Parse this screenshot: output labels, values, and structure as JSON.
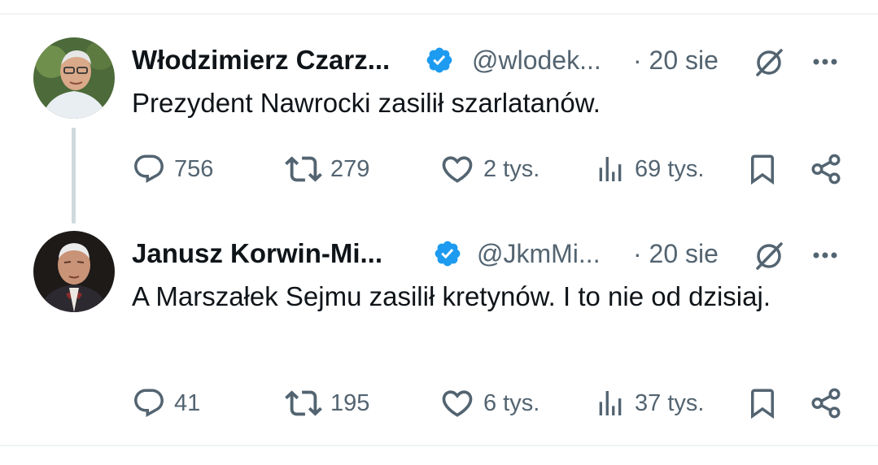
{
  "tweets": [
    {
      "author_name": "Włodzimierz Czarz...",
      "handle": "@wlodek...",
      "date": "· 20 sie",
      "text": "Prezydent Nawrocki zasilił szarlatanów.",
      "replies": "756",
      "reposts": "279",
      "likes": "2 tys.",
      "views": "69 tys."
    },
    {
      "author_name": "Janusz Korwin-Mi...",
      "handle": "@JkmMi...",
      "date": "· 20 sie",
      "text": "A Marszałek Sejmu zasilił kretynów. I to nie od dzisiaj.",
      "replies": "41",
      "reposts": "195",
      "likes": "6 tys.",
      "views": "37 tys."
    }
  ],
  "colors": {
    "verified": "#1d9bf0",
    "secondary_text": "#536471",
    "primary_text": "#0f1419",
    "divider": "#eff3f4",
    "thread_line": "#cfd9de"
  },
  "icons": [
    "verified-badge-icon",
    "grok-icon",
    "more-icon",
    "reply-icon",
    "repost-icon",
    "like-icon",
    "views-icon",
    "bookmark-icon",
    "share-icon"
  ]
}
